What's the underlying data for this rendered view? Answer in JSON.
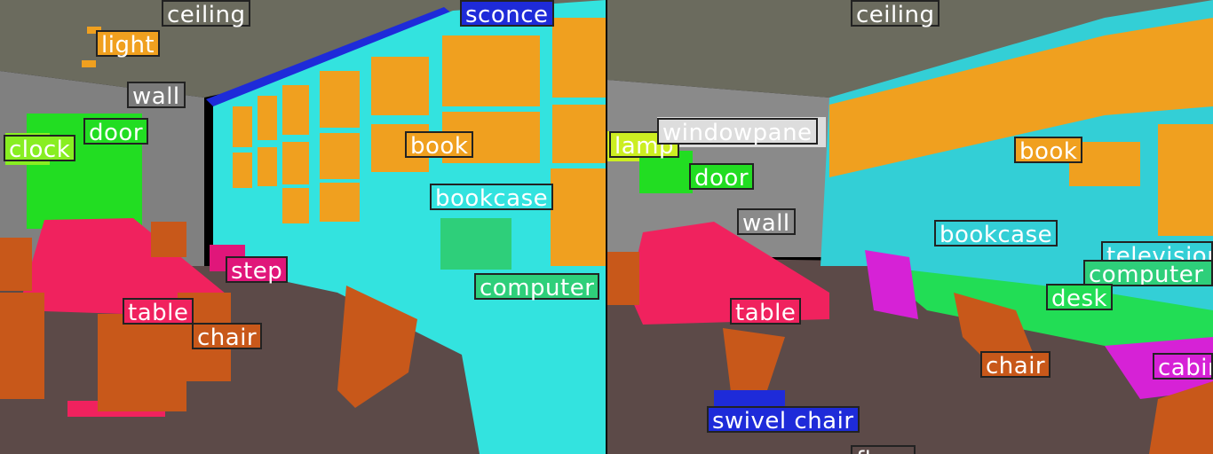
{
  "colors": {
    "ceiling": "#6b6b5e",
    "light": "#f0a01f",
    "wall": "#7a7a7a",
    "door": "#22dd22",
    "clock": "#88ee22",
    "sconce": "#1e2bd9",
    "book": "#f0a01f",
    "bookcase": "#33e3df",
    "step": "#e0167a",
    "table": "#f0225e",
    "chair": "#c8581a",
    "computer": "#2ecf7a",
    "lamp": "#ccee22",
    "windowpane": "#dddddd",
    "television": "#33cfd6",
    "desk": "#22dd55",
    "cabinet": "#d622d6",
    "swivel_chair": "#1e2bd9",
    "floor": "#5c4a48"
  },
  "left_panel": {
    "labels": {
      "ceiling": "ceiling",
      "light": "light",
      "wall": "wall",
      "door": "door",
      "clock": "clock",
      "sconce": "sconce",
      "book": "book",
      "bookcase": "bookcase",
      "step": "step",
      "computer": "computer",
      "table": "table",
      "chair": "chair"
    }
  },
  "right_panel": {
    "labels": {
      "ceiling": "ceiling",
      "lamp": "lamp",
      "windowpane": "windowpane",
      "door": "door",
      "book": "book",
      "wall": "wall",
      "bookcase": "bookcase",
      "television": "television",
      "computer": "computer",
      "desk": "desk",
      "table": "table",
      "chair": "chair",
      "cabinet": "cabinet",
      "swivel_chair": "swivel chair",
      "floor": "floor"
    }
  }
}
